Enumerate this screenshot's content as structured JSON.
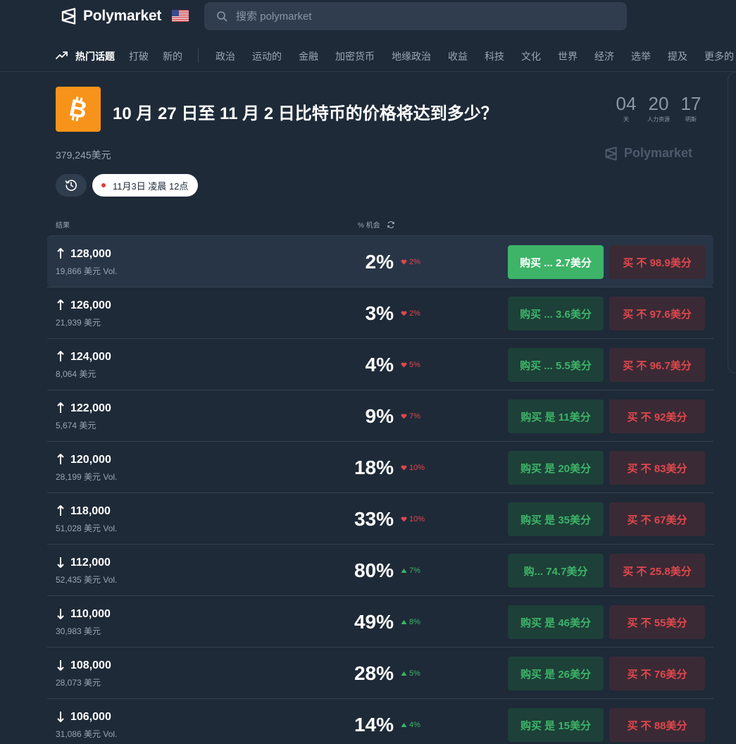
{
  "header": {
    "brand": "Polymarket",
    "search_placeholder": "搜索 polymarket"
  },
  "nav": {
    "items": [
      {
        "label": "热门话题",
        "active": true
      },
      {
        "label": "打破"
      },
      {
        "label": "新的"
      },
      {
        "label": "政治"
      },
      {
        "label": "运动的"
      },
      {
        "label": "金融"
      },
      {
        "label": "加密货币"
      },
      {
        "label": "地缘政治"
      },
      {
        "label": "收益"
      },
      {
        "label": "科技"
      },
      {
        "label": "文化"
      },
      {
        "label": "世界"
      },
      {
        "label": "经济"
      },
      {
        "label": "选举"
      },
      {
        "label": "提及"
      },
      {
        "label": "更多的"
      }
    ]
  },
  "event": {
    "title": "10 月 27 日至 11 月 2 日比特币的价格将达到多少？",
    "volume": "379,245美元",
    "countdown": [
      {
        "value": "04",
        "label": "天"
      },
      {
        "value": "20",
        "label": "人力资源"
      },
      {
        "value": "17",
        "label": "明斯"
      }
    ],
    "watermark": "Polymarket",
    "date_pill": "11月3日 凌晨 12点"
  },
  "table": {
    "col_outcome": "结果",
    "col_chance": "% 机会"
  },
  "colors": {
    "background": "#1e2a38",
    "yes_green": "#3db468",
    "no_red": "#e0474c",
    "btc_orange": "#f7931a"
  },
  "outcomes": [
    {
      "direction": "up",
      "label": "128,000",
      "volume": "19,866 美元 Vol.",
      "chance": "2%",
      "change": "2%",
      "change_dir": "down",
      "yes": "购买 ... 2.7美分",
      "no": "买 不 98.9美分"
    },
    {
      "direction": "up",
      "label": "126,000",
      "volume": "21,939 美元",
      "chance": "3%",
      "change": "2%",
      "change_dir": "down",
      "yes": "购买 ... 3.6美分",
      "no": "买 不 97.6美分"
    },
    {
      "direction": "up",
      "label": "124,000",
      "volume": "8,064 美元",
      "chance": "4%",
      "change": "5%",
      "change_dir": "down",
      "yes": "购买 ... 5.5美分",
      "no": "买 不 96.7美分"
    },
    {
      "direction": "up",
      "label": "122,000",
      "volume": "5,674 美元",
      "chance": "9%",
      "change": "7%",
      "change_dir": "down",
      "yes": "购买 是 11美分",
      "no": "买 不 92美分"
    },
    {
      "direction": "up",
      "label": "120,000",
      "volume": "28,199 美元 Vol.",
      "chance": "18%",
      "change": "10%",
      "change_dir": "down",
      "yes": "购买 是 20美分",
      "no": "买 不 83美分"
    },
    {
      "direction": "up",
      "label": "118,000",
      "volume": "51,028 美元 Vol.",
      "chance": "33%",
      "change": "10%",
      "change_dir": "down",
      "yes": "购买 是 35美分",
      "no": "买 不 67美分"
    },
    {
      "direction": "down",
      "label": "112,000",
      "volume": "52,435 美元 Vol.",
      "chance": "80%",
      "change": "7%",
      "change_dir": "up",
      "yes": "购... 74.7美分",
      "no": "买 不 25.8美分"
    },
    {
      "direction": "down",
      "label": "110,000",
      "volume": "30,983 美元",
      "chance": "49%",
      "change": "8%",
      "change_dir": "up",
      "yes": "购买 是 46美分",
      "no": "买 不 55美分"
    },
    {
      "direction": "down",
      "label": "108,000",
      "volume": "28,073 美元",
      "chance": "28%",
      "change": "5%",
      "change_dir": "up",
      "yes": "购买 是 26美分",
      "no": "买 不 76美分"
    },
    {
      "direction": "down",
      "label": "106,000",
      "volume": "31,086 美元 Vol.",
      "chance": "14%",
      "change": "4%",
      "change_dir": "up",
      "yes": "购买 是 15美分",
      "no": "买 不 88美分"
    }
  ]
}
